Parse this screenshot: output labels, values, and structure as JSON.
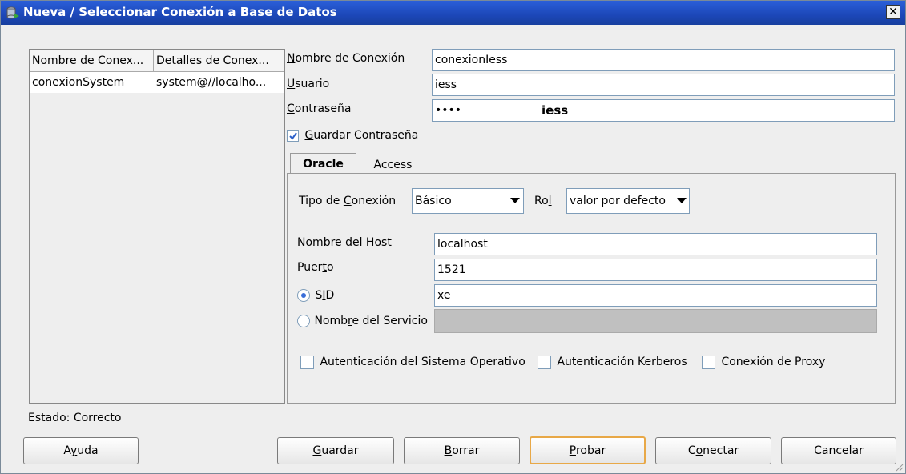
{
  "window": {
    "title": "Nueva / Seleccionar Conexión a Base de Datos"
  },
  "connections": {
    "headers": [
      "Nombre de Conex...",
      "Detalles de Conex..."
    ],
    "rows": [
      {
        "name": "conexionSystem",
        "details": "system@//localho..."
      }
    ]
  },
  "form": {
    "name_label": "Nombre de Conexión",
    "name_value": "conexionIess",
    "user_label": "Usuario",
    "user_value": "iess",
    "password_label": "Contraseña",
    "password_masked": "••••",
    "password_overlay": "iess",
    "save_password_label": "Guardar Contraseña",
    "save_password_checked": true
  },
  "tabs": [
    {
      "label": "Oracle",
      "active": true
    },
    {
      "label": "Access",
      "active": false
    }
  ],
  "oracle": {
    "conn_type_label": "Tipo de Conexión",
    "conn_type_value": "Básico",
    "role_label": "Rol",
    "role_value": "valor por defecto",
    "host_label": "Nombre del Host",
    "host_value": "localhost",
    "port_label": "Puerto",
    "port_value": "1521",
    "sid_label": "SID",
    "sid_value": "xe",
    "service_label": "Nombre del Servicio",
    "service_value": "",
    "os_auth_label": "Autenticación del Sistema Operativo",
    "kerberos_label": "Autenticación Kerberos",
    "proxy_label": "Conexión de Proxy"
  },
  "status": {
    "text": "Estado: Correcto"
  },
  "buttons": {
    "help": "Ayuda",
    "save": "Guardar",
    "delete": "Borrar",
    "test": "Probar",
    "connect": "Conectar",
    "cancel": "Cancelar"
  }
}
